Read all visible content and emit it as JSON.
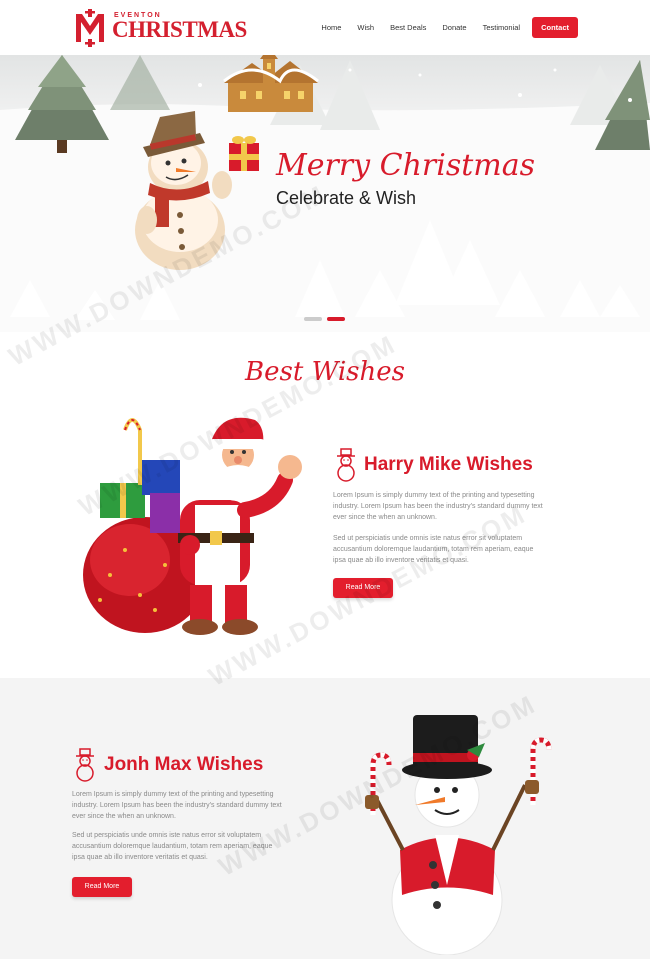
{
  "brand": {
    "small": "EVENTON",
    "big": "CHRISTMAS",
    "accent": "#e31e2d"
  },
  "nav": {
    "items": [
      "Home",
      "Wish",
      "Best Deals",
      "Donate",
      "Testimonial"
    ],
    "contact": "Contact"
  },
  "hero": {
    "title": "Merry Christmas",
    "subtitle": "Celebrate & Wish",
    "slides": 2,
    "active_slide": 2
  },
  "section": {
    "title": "Best Wishes"
  },
  "wishes": [
    {
      "title": "Harry Mike Wishes",
      "text1_l1": "Lorem Ipsum is simply dummy text of the printing and typesetting",
      "text1_l2": "industry. Lorem Ipsum has been the industry's standard dummy text",
      "text1_l3": "ever since the when an unknown.",
      "text2_l1": "Sed ut perspiciatis unde omnis iste natus error sit voluptatem",
      "text2_l2": "accusantium doloremque laudantium, totam rem aperiam, eaque",
      "text2_l3": "ipsa quae ab illo inventore veritatis et quasi.",
      "button": "Read More",
      "icon": "snowman-icon"
    },
    {
      "title": "Jonh Max Wishes",
      "text1_l1": "Lorem Ipsum is simply dummy text of the printing and typesetting",
      "text1_l2": "industry. Lorem Ipsum has been the industry's standard dummy text",
      "text1_l3": "ever since the when an unknown.",
      "text2_l1": "Sed ut perspiciatis unde omnis iste natus error sit voluptatem",
      "text2_l2": "accusantium doloremque laudantium, totam rem aperiam, eaque",
      "text2_l3": "ipsa quae ab illo inventore veritatis et quasi.",
      "button": "Read More",
      "icon": "snowman-icon"
    }
  ],
  "watermark": "WWW.DOWNDEMO.COM"
}
